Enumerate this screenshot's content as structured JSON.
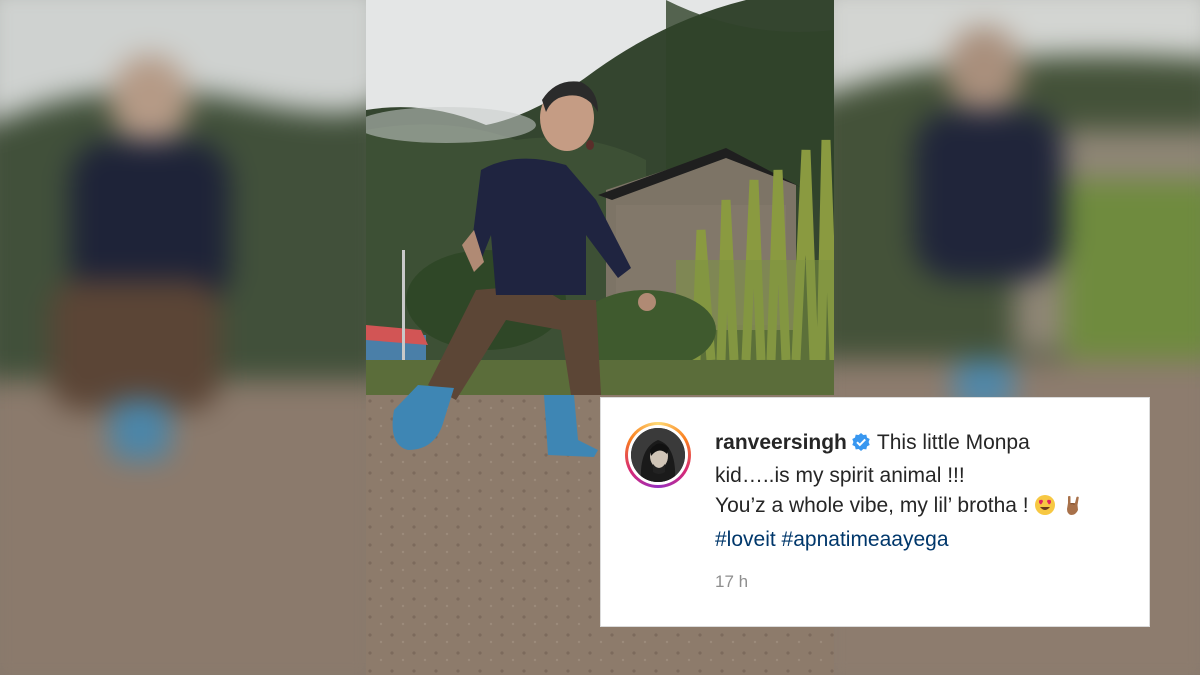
{
  "post": {
    "username": "ranveersingh",
    "verified": true,
    "caption_line1": "This little Monpa",
    "caption_line2": "kid…..is my spirit animal !!!",
    "caption_line3": "You’z a whole vibe, my lil’ brotha !",
    "emojis": [
      "heart-eyes-emoji",
      "rock-on-hand-emoji"
    ],
    "hashtags": [
      "#loveit",
      "#apnatimeaayega"
    ],
    "timestamp": "17 h"
  },
  "colors": {
    "verified_badge": "#3897f0",
    "hashtag": "#00376b",
    "text": "#262626",
    "muted": "#8e8e8e"
  }
}
